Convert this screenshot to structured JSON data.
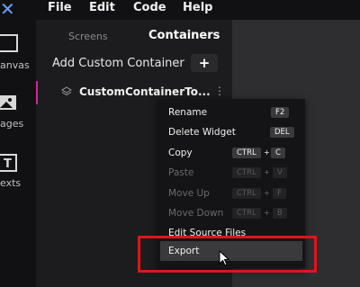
{
  "menubar": {
    "items": [
      "File",
      "Edit",
      "Code",
      "Help"
    ]
  },
  "rail": {
    "items": [
      {
        "label": "anvas",
        "icon": "canvas-icon"
      },
      {
        "label": "ages",
        "icon": "images-icon"
      },
      {
        "label": "exts",
        "icon": "texts-icon"
      }
    ]
  },
  "panel": {
    "tabs": {
      "screens": "Screens",
      "containers": "Containers"
    },
    "add": {
      "label": "Add Custom Container",
      "button": "+"
    },
    "item": {
      "name": "CustomContainerTo..."
    }
  },
  "context_menu": {
    "items": [
      {
        "label": "Rename",
        "keys": [
          "F2"
        ],
        "enabled": true
      },
      {
        "label": "Delete Widget",
        "keys": [
          "DEL"
        ],
        "enabled": true
      },
      {
        "label": "Copy",
        "keys": [
          "CTRL",
          "C"
        ],
        "enabled": true
      },
      {
        "label": "Paste",
        "keys": [
          "CTRL",
          "V"
        ],
        "enabled": false
      },
      {
        "label": "Move Up",
        "keys": [
          "CTRL",
          "F"
        ],
        "enabled": false
      },
      {
        "label": "Move Down",
        "keys": [
          "CTRL",
          "B"
        ],
        "enabled": false
      },
      {
        "label": "Edit Source Files",
        "keys": [],
        "enabled": true
      },
      {
        "label": "Export",
        "keys": [],
        "enabled": true
      }
    ],
    "key_joiner": "+"
  },
  "colors": {
    "accent": "#e0209a",
    "highlight": "#e0141a",
    "logo": "#6aa0ff"
  }
}
